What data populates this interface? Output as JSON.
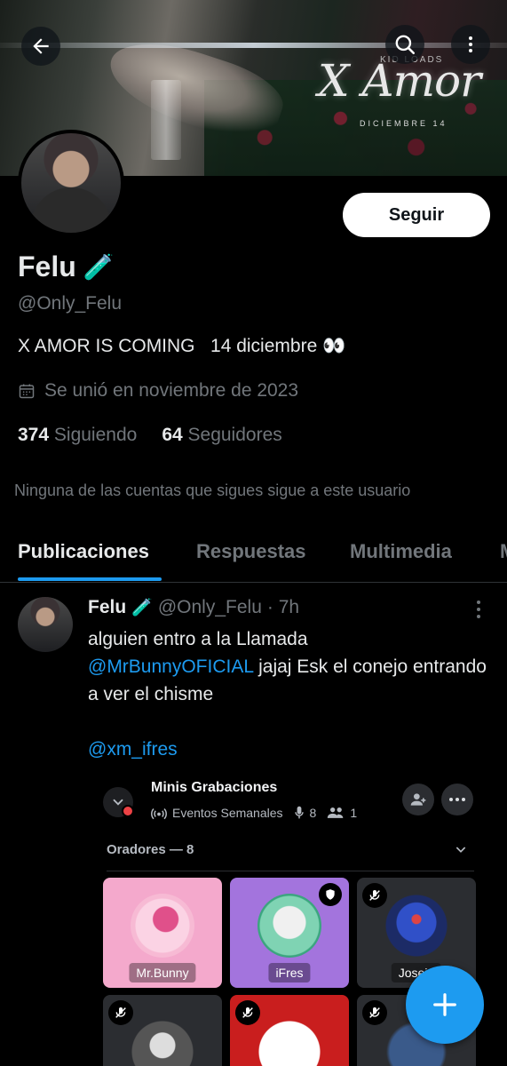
{
  "banner": {
    "title": "X Amor",
    "top_text": "KID LOADS",
    "date_text": "DICIEMBRE 14"
  },
  "profile": {
    "name": "Felu",
    "name_emoji": "🧪",
    "handle": "@Only_Felu",
    "bio": "X AMOR IS COMING   14 diciembre 👀",
    "joined": "Se unió en noviembre de 2023",
    "following_count": "374",
    "following_label": "Siguiendo",
    "followers_count": "64",
    "followers_label": "Seguidores",
    "notice": "Ninguna de las cuentas que sigues sigue a este usuario",
    "follow_button": "Seguir"
  },
  "tabs": [
    "Publicaciones",
    "Respuestas",
    "Multimedia",
    "M"
  ],
  "post": {
    "name": "Felu",
    "name_emoji": "🧪",
    "handle": "@Only_Felu",
    "time": "· 7h",
    "text_1": "alguien entro a la Llamada",
    "mention_1": "@MrBunnyOFICIAL",
    "text_2": " jajaj Esk el conejo entrando a ver el chisme",
    "mention_2": "@xm_ifres"
  },
  "space_card": {
    "title": "Minis Grabaciones",
    "channel": "Eventos Semanales",
    "mic_count": "8",
    "people_count": "1",
    "speakers_label": "Oradores — 8",
    "tiles": [
      {
        "name": "Mr.Bunny",
        "bg": "#f4a9cc"
      },
      {
        "name": "iFres",
        "bg": "#a374dd"
      },
      {
        "name": "Joseia",
        "bg": "#2b2d31"
      }
    ]
  },
  "colors": {
    "accent": "#1d9bf0",
    "muted": "#71767b",
    "text": "#e7e9ea"
  }
}
